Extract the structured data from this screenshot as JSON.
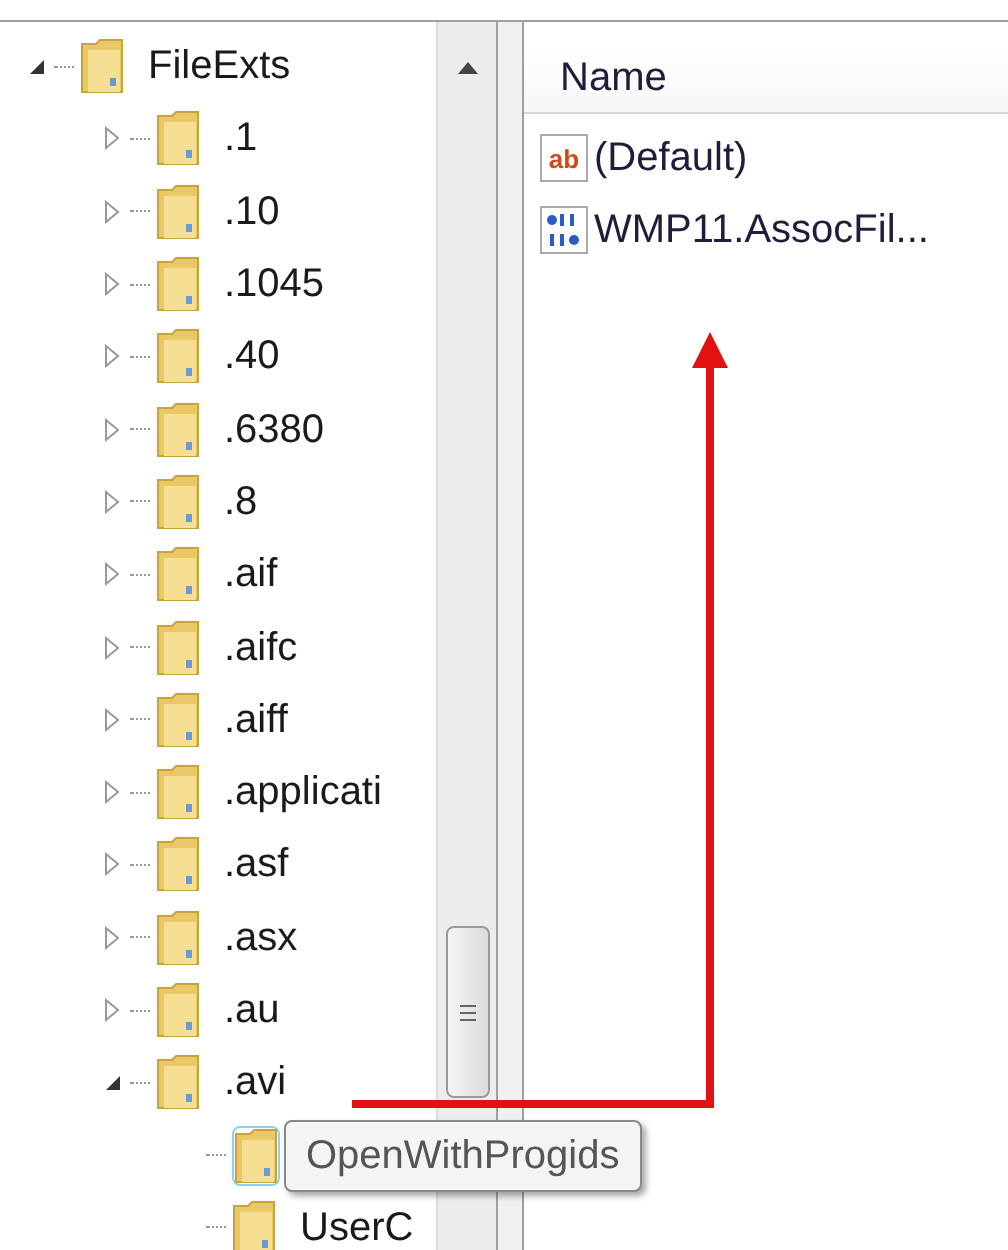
{
  "tree": {
    "label": "FileExts",
    "expanded": true,
    "children": [
      {
        "label": ".1",
        "expanded": false
      },
      {
        "label": ".10",
        "expanded": false
      },
      {
        "label": ".1045",
        "expanded": false
      },
      {
        "label": ".40",
        "expanded": false
      },
      {
        "label": ".6380",
        "expanded": false
      },
      {
        "label": ".8",
        "expanded": false
      },
      {
        "label": ".aif",
        "expanded": false
      },
      {
        "label": ".aifc",
        "expanded": false
      },
      {
        "label": ".aiff",
        "expanded": false
      },
      {
        "label": ".applicati",
        "expanded": false
      },
      {
        "label": ".asf",
        "expanded": false
      },
      {
        "label": ".asx",
        "expanded": false
      },
      {
        "label": ".au",
        "expanded": false
      },
      {
        "label": ".avi",
        "expanded": true,
        "children": [
          {
            "label": "OpenWithProgids",
            "selected": true
          },
          {
            "label": "UserC",
            "selected": false
          }
        ]
      }
    ]
  },
  "values": {
    "column": "Name",
    "rows": [
      {
        "kind": "string",
        "icon_label": "ab",
        "name": "(Default)"
      },
      {
        "kind": "binary",
        "name": "WMP11.AssocFil..."
      }
    ]
  }
}
